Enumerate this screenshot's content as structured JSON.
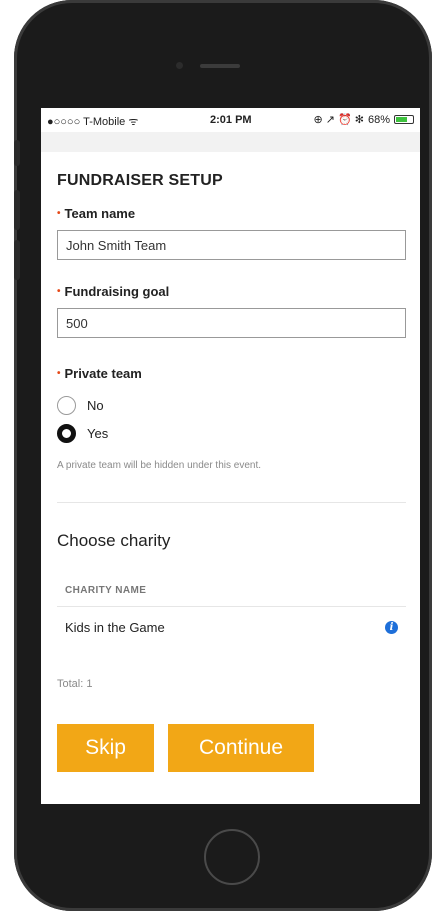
{
  "status_bar": {
    "carrier": "●○○○○ T-Mobile ᯤ",
    "time": "2:01 PM",
    "indicators": "⊕ ↗ ⏰ ✻",
    "battery_percent": "68%",
    "battery_level": 0.68
  },
  "form": {
    "title": "FUNDRAISER SETUP",
    "required_marker": "•",
    "team_name": {
      "label": "Team name",
      "value": "John Smith Team"
    },
    "goal": {
      "label": "Fundraising goal",
      "value": "500"
    },
    "private_team": {
      "label": "Private team",
      "options": [
        {
          "label": "No",
          "selected": false
        },
        {
          "label": "Yes",
          "selected": true
        }
      ],
      "hint": "A private team will be hidden under this event."
    }
  },
  "charity": {
    "section_title": "Choose charity",
    "column_header": "CHARITY NAME",
    "rows": [
      {
        "name": "Kids in the Game",
        "icon": "info-icon"
      }
    ],
    "total_label": "Total: 1"
  },
  "actions": {
    "skip_label": "Skip",
    "continue_label": "Continue"
  },
  "colors": {
    "accent": "#f2a716",
    "required": "#e64a19",
    "info": "#1e6fd9",
    "battery": "#3ec23e"
  }
}
